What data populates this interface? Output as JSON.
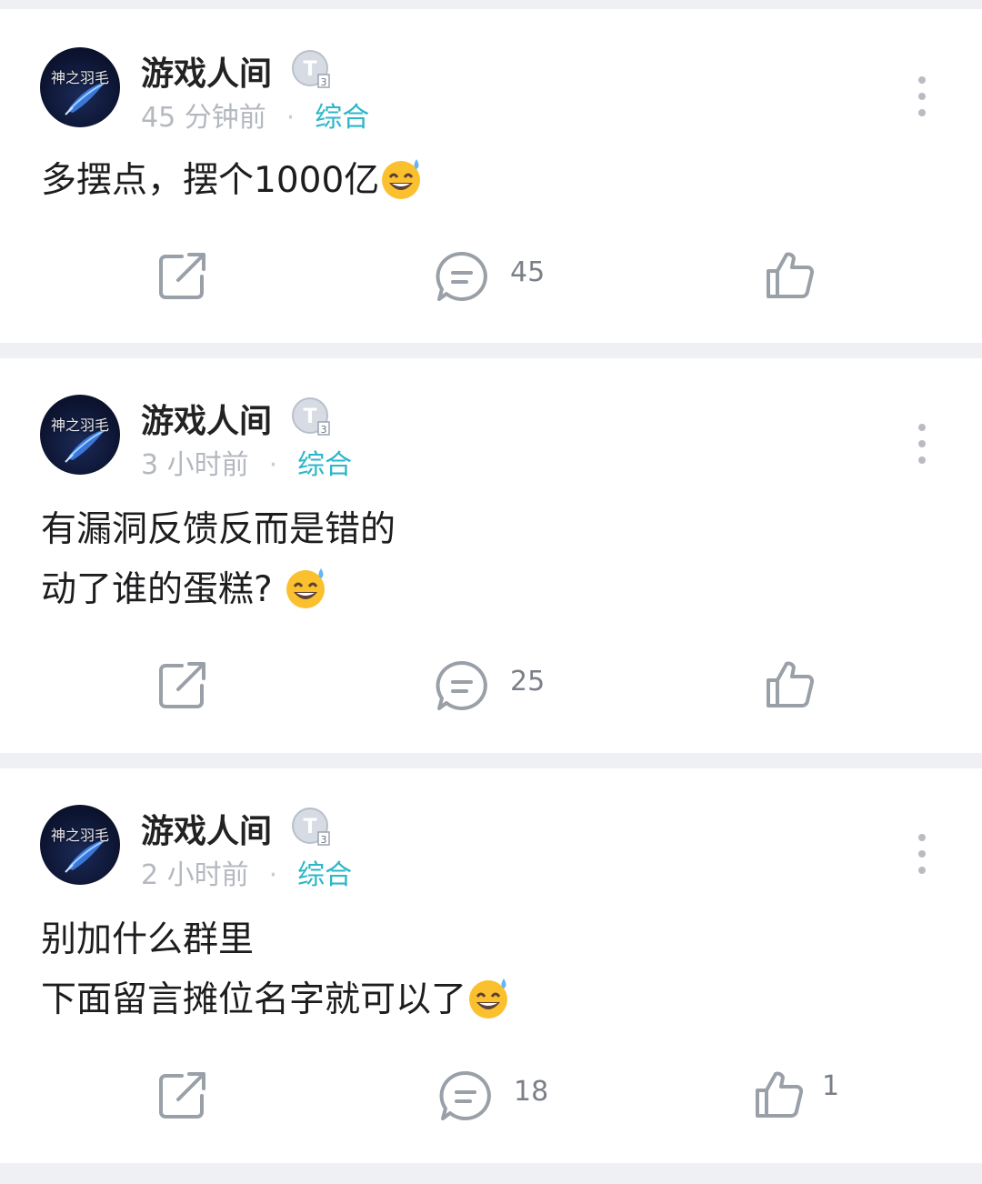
{
  "posts": [
    {
      "username": "游戏人间",
      "avatar_text": "神之羽毛",
      "level_icon": "level-badge-icon",
      "time": "45 分钟前",
      "category": "综合",
      "lines": [
        "多摆点，摆个1000亿"
      ],
      "emoji": "grinning-sweat-emoji",
      "share_icon": "share-icon",
      "comment_count": "45",
      "like_count": ""
    },
    {
      "username": "游戏人间",
      "avatar_text": "神之羽毛",
      "level_icon": "level-badge-icon",
      "time": "3 小时前",
      "category": "综合",
      "lines": [
        "有漏洞反馈反而是错的",
        "动了谁的蛋糕? "
      ],
      "emoji": "grinning-sweat-emoji",
      "share_icon": "share-icon",
      "comment_count": "25",
      "like_count": ""
    },
    {
      "username": "游戏人间",
      "avatar_text": "神之羽毛",
      "level_icon": "level-badge-icon",
      "time": "2 小时前",
      "category": "综合",
      "lines": [
        "别加什么群里",
        "下面留言摊位名字就可以了"
      ],
      "emoji": "grinning-sweat-emoji",
      "share_icon": "share-icon",
      "comment_count": "18",
      "like_count": "1"
    }
  ],
  "colors": {
    "background": "#eef0f3",
    "card": "#ffffff",
    "category": "#2bb6c9",
    "meta": "#b4b8bf",
    "icon": "#9aa0a8"
  }
}
